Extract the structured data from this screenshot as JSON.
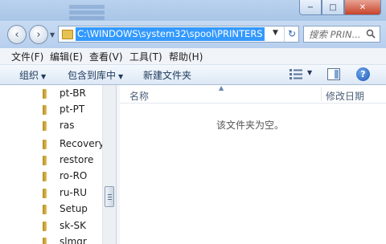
{
  "window": {
    "minimize_label": "−",
    "maximize_label": "□",
    "close_label": "✕"
  },
  "nav": {
    "back_icon": "‹",
    "forward_icon": "›",
    "address": "C:\\WINDOWS\\system32\\spool\\PRINTERS",
    "refresh_icon": "↻",
    "search_placeholder": "搜索 PRIN..."
  },
  "menu": {
    "file": "文件(F)",
    "edit": "编辑(E)",
    "view": "查看(V)",
    "tools": "工具(T)",
    "help": "帮助(H)"
  },
  "commands": {
    "organize": "组织",
    "include_in_library": "包含到库中",
    "new_folder": "新建文件夹",
    "help_icon": "?"
  },
  "tree": {
    "items": [
      {
        "label": "pt-BR"
      },
      {
        "label": "pt-PT"
      },
      {
        "label": "ras"
      },
      {
        "label": "Recovery"
      },
      {
        "label": "restore"
      },
      {
        "label": "ro-RO"
      },
      {
        "label": "ru-RU"
      },
      {
        "label": "Setup"
      },
      {
        "label": "sk-SK"
      },
      {
        "label": "slmgr"
      }
    ]
  },
  "content": {
    "col_name": "名称",
    "col_date": "修改日期",
    "empty_message": "该文件夹为空。"
  },
  "colors": {
    "address_highlight": "#3399ff",
    "close_button": "#c7432a",
    "folder": "#e5c15a"
  }
}
